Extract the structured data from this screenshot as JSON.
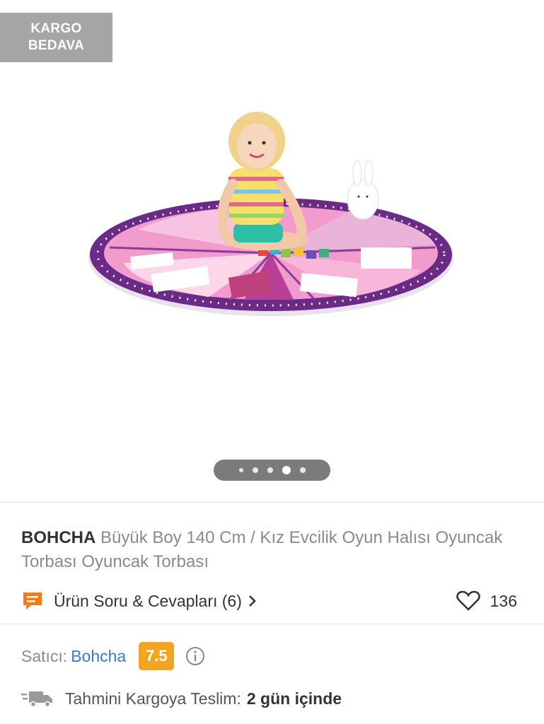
{
  "badge": {
    "line1": "KARGO",
    "line2": "BEDAVA"
  },
  "gallery": {
    "image_count": 5,
    "active_index": 3,
    "image_icon": "play-mat-photo"
  },
  "product": {
    "brand": "BOHCHA",
    "title": "Büyük Boy 140 Cm / Kız Evcilik Oyun Halısı Oyuncak Torbası Oyuncak Torbası"
  },
  "qa": {
    "icon": "chat-icon",
    "label": "Ürün Soru & Cevapları (6)"
  },
  "favorites": {
    "icon": "heart-icon",
    "count": "136"
  },
  "seller": {
    "label": "Satıcı:",
    "name": "Bohcha",
    "score": "7.5",
    "score_color": "#f2a523"
  },
  "shipping": {
    "icon": "truck-icon",
    "label": "Tahmini Kargoya Teslim:",
    "value": "2 gün içinde"
  },
  "colors": {
    "accent_orange": "#f2a523",
    "link_blue": "#3a7bc8",
    "badge_gray": "#a5a5a5"
  }
}
